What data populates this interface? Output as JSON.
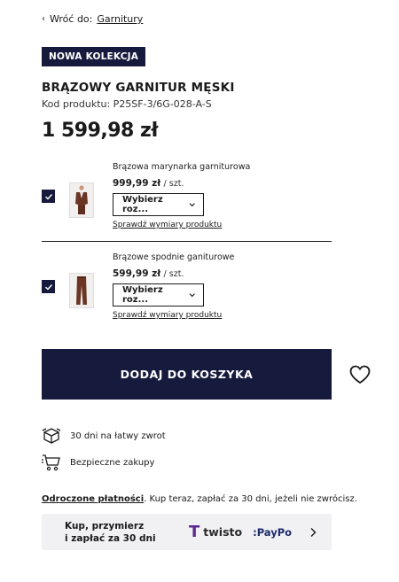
{
  "back": {
    "chevron": "‹",
    "prefix": "Wróć do:",
    "link": "Garnitury"
  },
  "badge": "NOWA KOLEKCJA",
  "product": {
    "title": "BRĄZOWY GARNITUR MĘSKI",
    "code": "Kod produktu: P25SF-3/6G-028-A-S",
    "price": "1 599,98 zł"
  },
  "items": [
    {
      "name": "Brązowa marynarka garniturowa",
      "price": "999,99 zł",
      "unit": "/ szt.",
      "size_select": "Wybierz roz...",
      "dims_link": "Sprawdź wymiary produktu",
      "checked": true
    },
    {
      "name": "Brązowe spodnie ganiturowe",
      "price": "599,99 zł",
      "unit": "/ szt.",
      "size_select": "Wybierz roz...",
      "dims_link": "Sprawdź wymiary produktu",
      "checked": true
    }
  ],
  "cart_button": "DODAJ DO KOSZYKA",
  "perks": [
    {
      "icon": "box-return-icon",
      "label": "30 dni na łatwy zwrot"
    },
    {
      "icon": "shopping-cart-icon",
      "label": "Bezpieczne zakupy"
    }
  ],
  "deferred": {
    "link": "Odroczone płatności",
    "text": ". Kup teraz, zapłać za 30 dni, jeżeli nie zwrócisz."
  },
  "twisto_banner": {
    "line1": "Kup, przymierz",
    "line2": "i zapłać za 30 dni",
    "brand1": "twisto",
    "brand2": ":PayPo"
  },
  "colors": {
    "primary": "#161a3c",
    "banner_bg": "#f1f1f4",
    "twisto_purple": "#5b2a8e"
  }
}
